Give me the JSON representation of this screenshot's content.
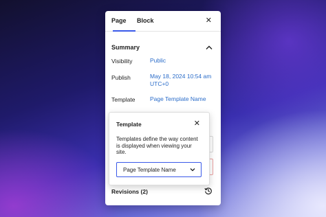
{
  "tabs": [
    {
      "label": "Page"
    },
    {
      "label": "Block"
    }
  ],
  "close_glyph": "✕",
  "summary": {
    "title": "Summary",
    "rows": [
      {
        "label": "Visibility",
        "value": "Public"
      },
      {
        "label": "Publish",
        "value_line1": "May 18, 2024 10:54 am",
        "value_line2": "UTC+0"
      },
      {
        "label": "Template",
        "value": "Page Template Name"
      }
    ]
  },
  "template_popover": {
    "title": "Template",
    "description": "Templates define the way content is displayed when viewing your site.",
    "selected_template": "Page Template Name"
  },
  "revisions": {
    "label": "Revisions (2)"
  },
  "colors": {
    "accent": "#3858e9",
    "link": "#2a6cc9",
    "text": "#1e1e1e"
  },
  "icons": [
    "close-icon",
    "chevron-up-icon",
    "chevron-down-icon",
    "history-icon"
  ]
}
